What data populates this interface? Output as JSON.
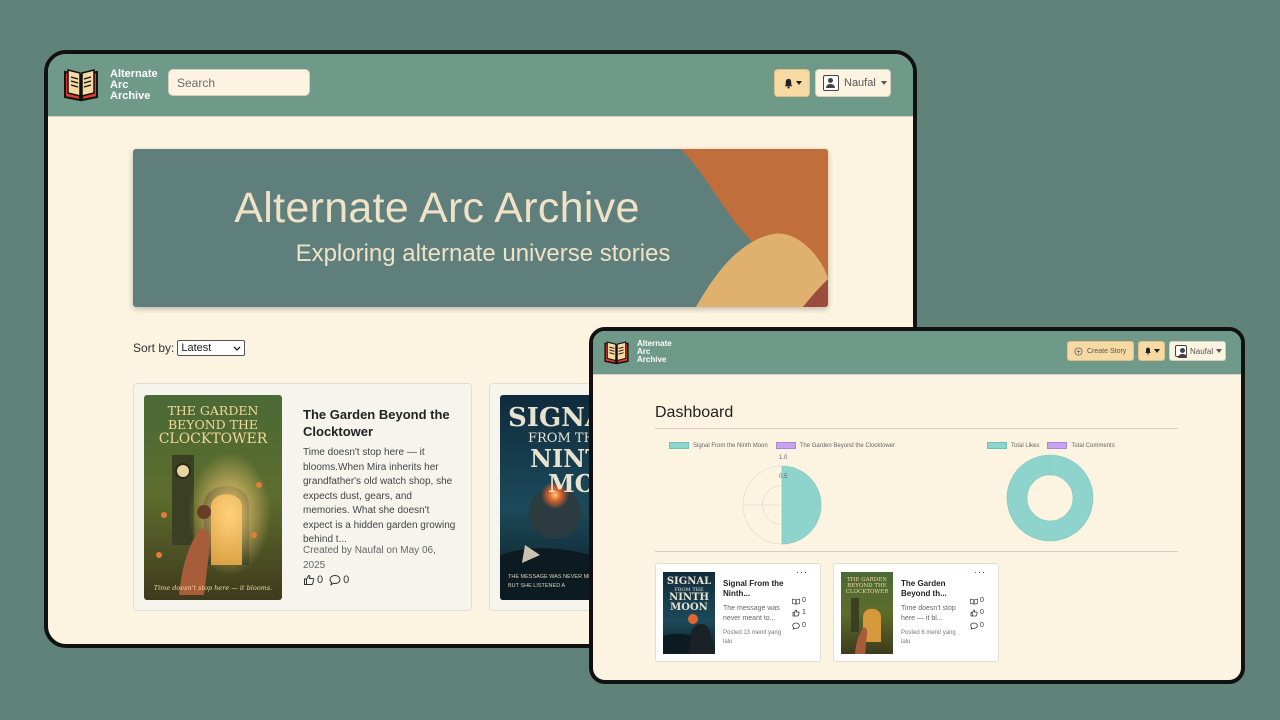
{
  "colors": {
    "background": "#5f8279",
    "navbar": "#6f9a89",
    "page": "#fdf3e1",
    "accent_button": "#f6d9a3",
    "hero": "#5f7f7c",
    "chart_teal": "#8fd3cd",
    "chart_purple": "#c7a4ef"
  },
  "main_window": {
    "brand": [
      "Alternate",
      "Arc",
      "Archive"
    ],
    "search_placeholder": "Search",
    "user_name": "Naufal",
    "hero": {
      "title": "Alternate Arc Archive",
      "subtitle": "Exploring alternate universe stories"
    },
    "sort": {
      "label": "Sort by:",
      "selected": "Latest"
    },
    "stories": [
      {
        "title": "The Garden Beyond the Clocktower",
        "cover_lines": [
          "THE GARDEN",
          "BEYOND THE",
          "CLOCKTOWER"
        ],
        "cover_tagline": "Time doesn't stop here — it blooms.",
        "description": "Time doesn't stop here — it blooms.When Mira inherits her grandfather's old watch shop, she expects dust, gears, and memories. What she doesn't expect is a hidden garden growing behind t...",
        "meta": "Created by Naufal on May 06, 2025",
        "likes": "0",
        "comments": "0"
      },
      {
        "title": "Signal From the Ninth Moon",
        "cover_lines": [
          "SIGNA",
          "FROM TH",
          "NINT",
          "MOO"
        ],
        "cover_tagline": [
          "THE MESSAGE WAS NEVER MEAN",
          "BUT SHE LISTENED A"
        ]
      }
    ]
  },
  "dashboard_window": {
    "brand": [
      "Alternate",
      "Arc",
      "Archive"
    ],
    "create_label": "Create Story",
    "user_name": "Naufal",
    "title": "Dashboard",
    "stories": [
      {
        "title": "Signal From the Ninth...",
        "cover_lines": [
          "SIGNAL",
          "FROM THE",
          "NINTH",
          "MOON"
        ],
        "description": "The message was never meant to...",
        "meta": "Posted 13 menit yang lalu",
        "reads": "0",
        "likes": "1",
        "comments": "0"
      },
      {
        "title": "The Garden Beyond th...",
        "cover_lines": [
          "THE GARDEN",
          "BEYOND THE",
          "CLOCKTOWER"
        ],
        "description": "Time doesn't stop here — it bl...",
        "meta": "Posted 6 menit yang lalu",
        "reads": "0",
        "likes": "0",
        "comments": "0"
      }
    ]
  },
  "chart_data": [
    {
      "type": "pie",
      "categories": [
        "Signal From the Ninth Moon",
        "The Garden Beyond the Clocktower"
      ],
      "values": [
        1,
        0
      ],
      "tick_labels": [
        "1.0",
        "0.5"
      ],
      "legend_position": "top"
    },
    {
      "type": "pie",
      "categories": [
        "Total Likes",
        "Total Comments"
      ],
      "values": [
        1,
        0
      ],
      "legend_position": "top"
    }
  ]
}
